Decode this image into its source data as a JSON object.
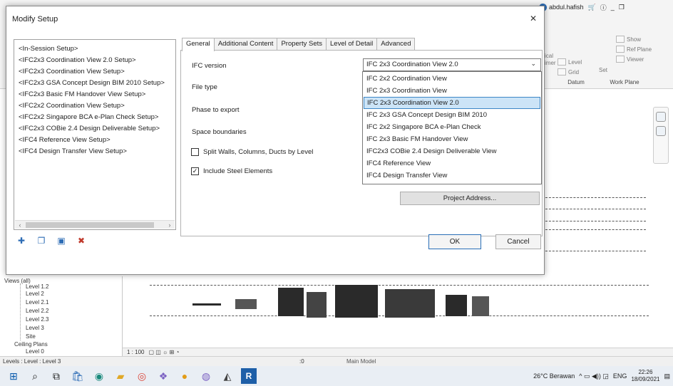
{
  "dialog": {
    "title": "Modify Setup",
    "setups": [
      "<In-Session Setup>",
      "<IFC2x3 Coordination View 2.0 Setup>",
      "<IFC2x3 Coordination View Setup>",
      "<IFC2x3 GSA Concept Design BIM 2010 Setup>",
      "<IFC2x3 Basic FM Handover View Setup>",
      "<IFC2x2 Coordination View Setup>",
      "<IFC2x2 Singapore BCA e-Plan Check Setup>",
      "<IFC2x3 COBie 2.4 Design Deliverable Setup>",
      "<IFC4 Reference View Setup>",
      "<IFC4 Design Transfer View Setup>"
    ],
    "tabs": [
      "General",
      "Additional Content",
      "Property Sets",
      "Level of Detail",
      "Advanced"
    ],
    "active_tab": "General",
    "labels": {
      "ifc_version": "IFC version",
      "file_type": "File type",
      "phase": "Phase to export",
      "space": "Space boundaries"
    },
    "checkboxes": [
      {
        "label": "Split Walls, Columns, Ducts by Level",
        "checked": false,
        "mark": ""
      },
      {
        "label": "Include Steel Elements",
        "checked": true,
        "mark": "✓"
      }
    ],
    "ifc_version_value": "IFC 2x3 Coordination View 2.0",
    "dropdown_options": [
      "IFC 2x2 Coordination View",
      "IFC 2x3 Coordination View",
      "IFC 2x3 Coordination View 2.0",
      "IFC 2x3 GSA Concept Design BIM 2010",
      "IFC 2x2 Singapore BCA e-Plan Check",
      "IFC 2x3 Basic FM Handover View",
      "IFC2x3 COBie 2.4 Design Deliverable View",
      "IFC4 Reference View",
      "IFC4 Design Transfer View"
    ],
    "selected_option": "IFC 2x3 Coordination View 2.0",
    "project_address_label": "Project Address...",
    "ok_label": "OK",
    "cancel_label": "Cancel"
  },
  "revit": {
    "user": "abdul.hafish",
    "ribbon": {
      "level": "Level",
      "grid": "Grid",
      "set": "Set",
      "show": "Show",
      "ref_plane": "Ref Plane",
      "viewer": "Viewer",
      "datum": "Datum",
      "work_plane": "Work Plane",
      "cut_left_1": "ical",
      "cut_left_2": "imer"
    },
    "browser": {
      "views": "Views (all)",
      "items": [
        "Level 2",
        "Level 2.1",
        "Level 2.2",
        "Level 2.3",
        "Level 3",
        "Site"
      ],
      "ceiling": "Ceiling Plans",
      "trunc_top": "Level 1.2",
      "trunc_bottom": "Level 0"
    },
    "scale": "1 : 100",
    "status_left": "Levels : Level : Level 3",
    "status_zero": ":0",
    "main_model": "Main Model"
  },
  "taskbar": {
    "weather": "26°C Berawan",
    "lang": "ENG",
    "time": "22:26",
    "date": "18/09/2021"
  },
  "colors": {
    "accent": "#2d6cb5",
    "selection_bg": "#cce4f7",
    "selection_border": "#3d86c6"
  }
}
